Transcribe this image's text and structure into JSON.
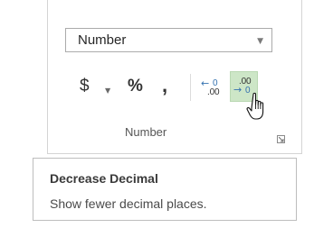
{
  "ribbon_group": {
    "name": "Number",
    "number_format": {
      "selected": "Number"
    },
    "buttons": {
      "accounting": {
        "symbol": "$"
      },
      "percent": {
        "symbol": "%"
      },
      "comma": {
        "symbol": ","
      },
      "increase_decimal": {
        "top": "0",
        "bottom": ".00"
      },
      "decrease_decimal": {
        "top": ".00",
        "bottom": "0"
      }
    },
    "hovered_button": "decrease_decimal",
    "colors": {
      "hover_background": "#cde6c7",
      "arrow_blue": "#3572b0"
    }
  },
  "tooltip": {
    "title": "Decrease Decimal",
    "description": "Show fewer decimal places."
  },
  "cursor": "hand-pointer-icon"
}
